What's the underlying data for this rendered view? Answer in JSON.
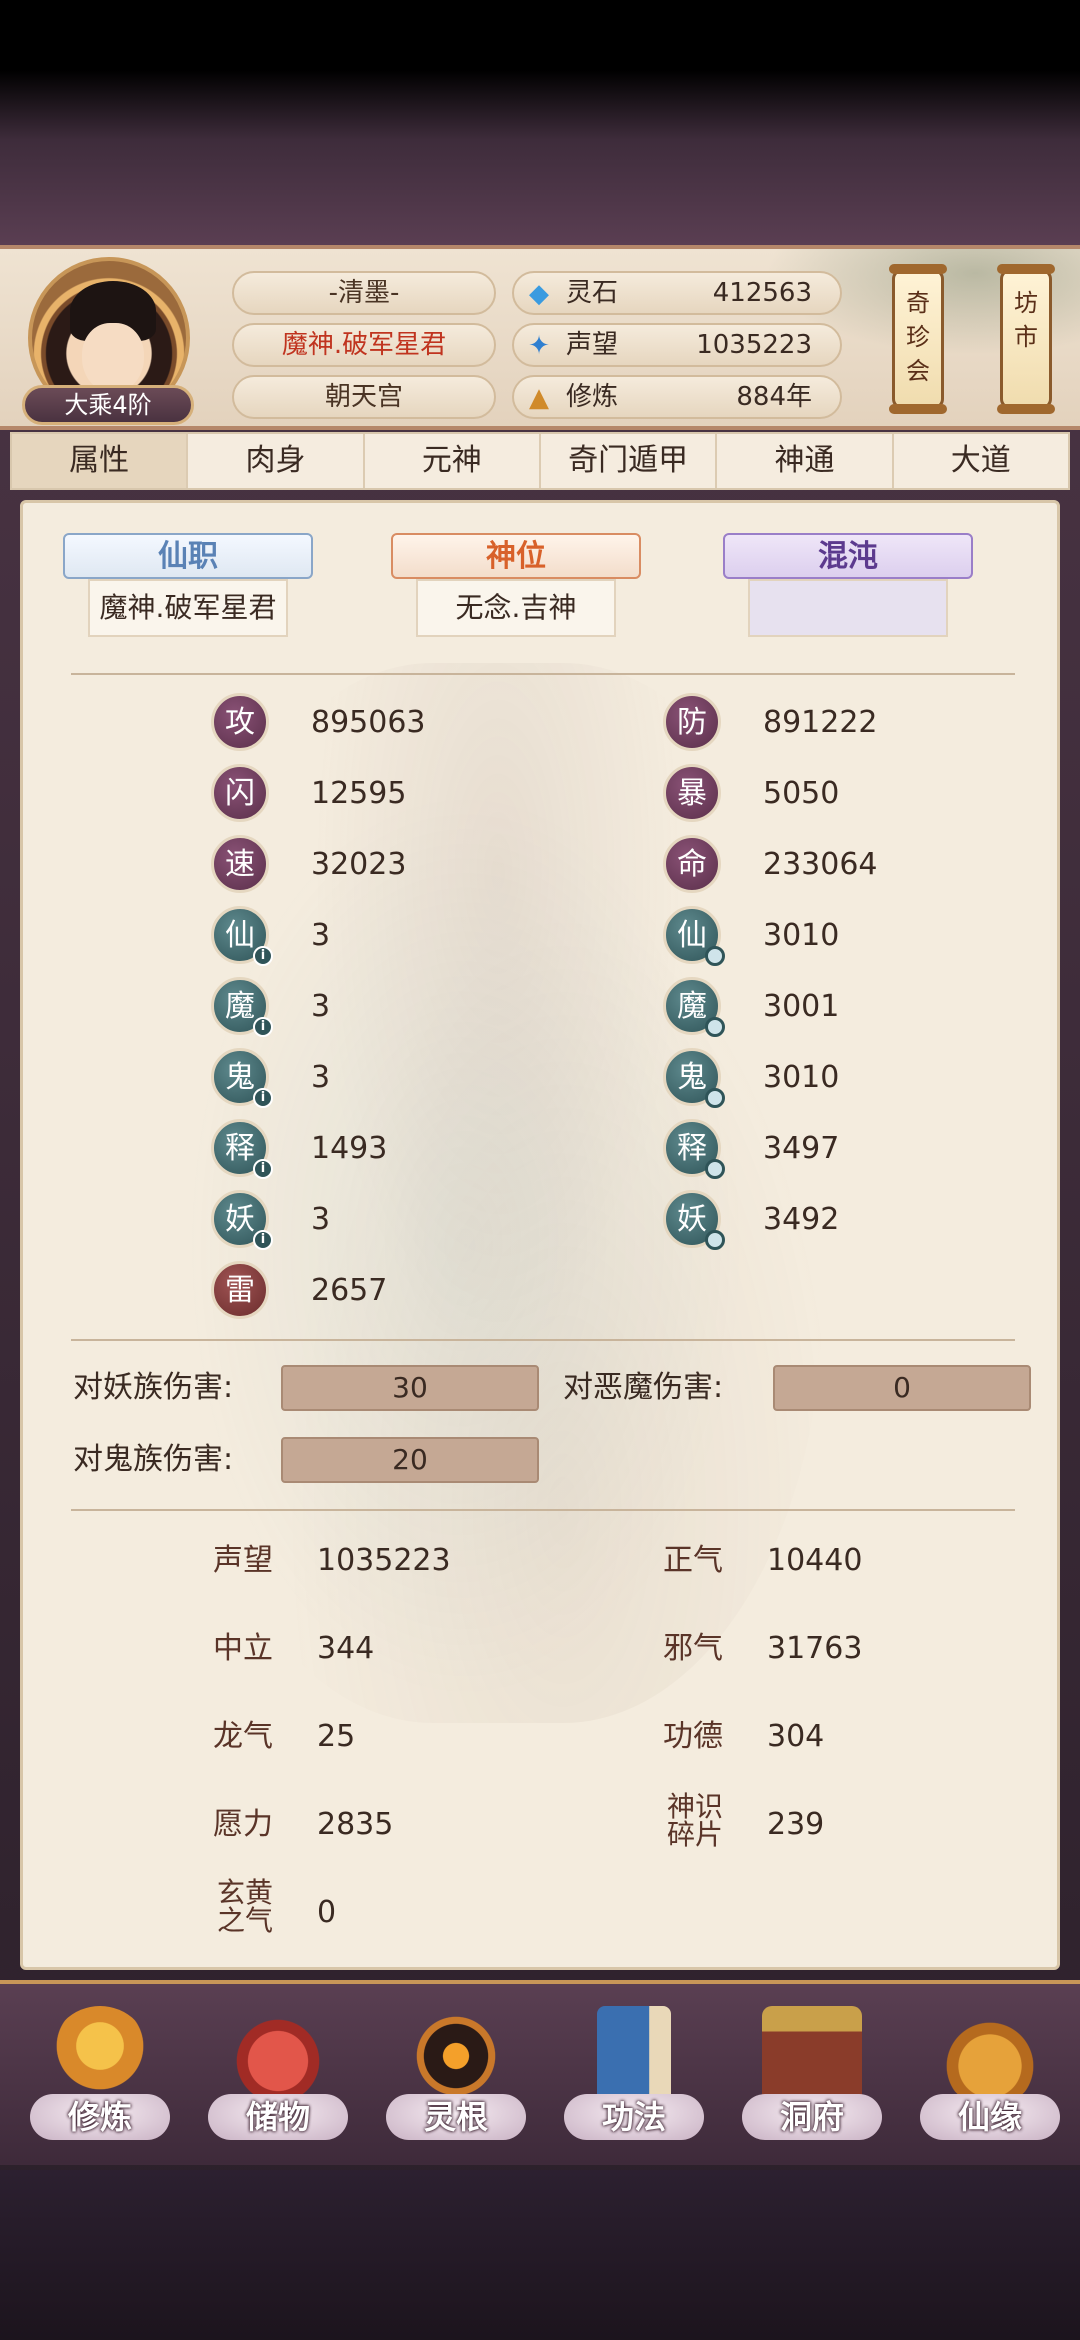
{
  "header": {
    "player_name": "-清墨-",
    "title": "魔神.破军星君",
    "location": "朝天宫",
    "rank": "大乘4阶",
    "resources": [
      {
        "icon": "spirit-stone-icon",
        "label": "灵石",
        "value": "412563"
      },
      {
        "icon": "reputation-icon",
        "label": "声望",
        "value": "1035223"
      },
      {
        "icon": "cultivation-icon",
        "label": "修炼",
        "value": "884年"
      }
    ],
    "buttons": {
      "treasure": "奇珍会",
      "market": "坊市"
    }
  },
  "tabs": [
    "属性",
    "肉身",
    "元神",
    "奇门遁甲",
    "神通",
    "大道"
  ],
  "active_tab": "属性",
  "ranks": [
    {
      "title": "仙职",
      "value": "魔神.破军星君"
    },
    {
      "title": "神位",
      "value": "无念.吉神"
    },
    {
      "title": "混沌",
      "value": ""
    }
  ],
  "stats_left": [
    {
      "badge": "攻",
      "value": "895063"
    },
    {
      "badge": "闪",
      "value": "12595"
    },
    {
      "badge": "速",
      "value": "32023"
    },
    {
      "badge": "仙",
      "value": "3"
    },
    {
      "badge": "魔",
      "value": "3"
    },
    {
      "badge": "鬼",
      "value": "3"
    },
    {
      "badge": "释",
      "value": "1493"
    },
    {
      "badge": "妖",
      "value": "3"
    },
    {
      "badge": "雷",
      "value": "2657"
    }
  ],
  "stats_right": [
    {
      "badge": "防",
      "value": "891222"
    },
    {
      "badge": "暴",
      "value": "5050"
    },
    {
      "badge": "命",
      "value": "233064"
    },
    {
      "badge": "仙",
      "value": "3010"
    },
    {
      "badge": "魔",
      "value": "3001"
    },
    {
      "badge": "鬼",
      "value": "3010"
    },
    {
      "badge": "释",
      "value": "3497"
    },
    {
      "badge": "妖",
      "value": "3492"
    }
  ],
  "damage": [
    {
      "label": "对妖族伤害:",
      "value": "30"
    },
    {
      "label": "对恶魔伤害:",
      "value": "0"
    },
    {
      "label": "对鬼族伤害:",
      "value": "20"
    }
  ],
  "misc_left": [
    {
      "label": "声望",
      "value": "1035223"
    },
    {
      "label": "中立",
      "value": "344"
    },
    {
      "label": "龙气",
      "value": "25"
    },
    {
      "label": "愿力",
      "value": "2835"
    },
    {
      "label": "玄黄之气",
      "value": "0"
    }
  ],
  "misc_right": [
    {
      "label": "正气",
      "value": "10440"
    },
    {
      "label": "邪气",
      "value": "31763"
    },
    {
      "label": "功德",
      "value": "304"
    },
    {
      "label": "神识碎片",
      "value": "239"
    }
  ],
  "nav": [
    "修炼",
    "储物",
    "灵根",
    "功法",
    "洞府",
    "仙缘"
  ]
}
